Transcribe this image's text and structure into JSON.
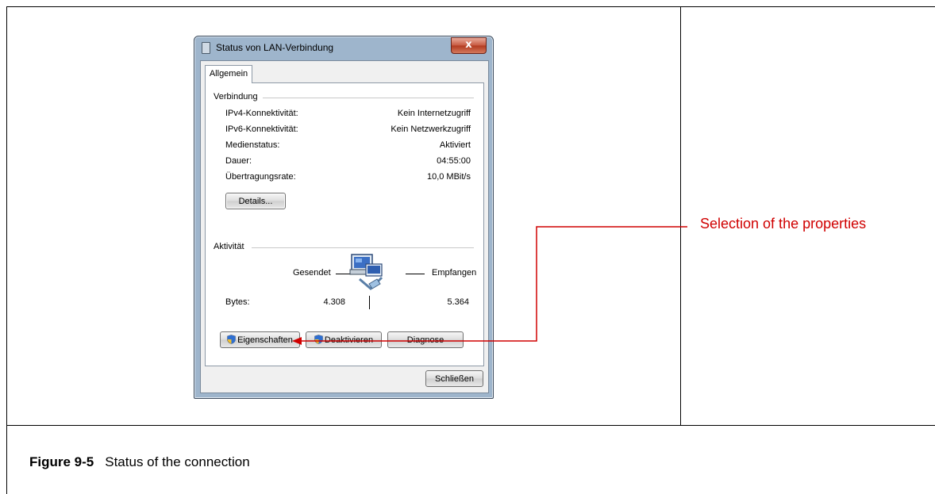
{
  "window": {
    "title": "Status von LAN-Verbindung",
    "close_label": "x",
    "tab_label": "Allgemein"
  },
  "connection": {
    "group_label": "Verbindung",
    "rows": [
      {
        "label": "IPv4-Konnektivität:",
        "value": "Kein Internetzugriff"
      },
      {
        "label": "IPv6-Konnektivität:",
        "value": "Kein Netzwerkzugriff"
      },
      {
        "label": "Medienstatus:",
        "value": "Aktiviert"
      },
      {
        "label": "Dauer:",
        "value": "04:55:00"
      },
      {
        "label": "Übertragungsrate:",
        "value": "10,0 MBit/s"
      }
    ],
    "details_button": "Details..."
  },
  "activity": {
    "group_label": "Aktivität",
    "sent_label": "Gesendet",
    "received_label": "Empfangen",
    "bytes_label": "Bytes:",
    "bytes_sent": "4.308",
    "bytes_received": "5.364"
  },
  "buttons": {
    "properties": "Eigenschaften",
    "disable": "Deaktivieren",
    "diagnose": "Diagnose",
    "close": "Schließen"
  },
  "annotation": {
    "text": "Selection of the properties",
    "color": "#d00000"
  },
  "caption": {
    "number": "Figure 9-5",
    "text": "Status of the connection"
  },
  "icons": [
    "network-adapter-icon",
    "uac-shield-icon",
    "close-icon"
  ]
}
